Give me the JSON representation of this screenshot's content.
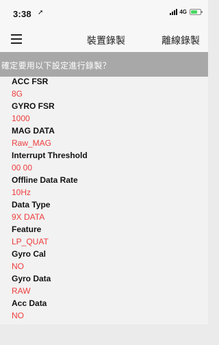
{
  "status_bar": {
    "time": "3:38",
    "network": "4G"
  },
  "nav": {
    "title": "裝置錄製",
    "action": "離線錄製"
  },
  "prompt": "確定要用以下設定進行錄製？",
  "settings": [
    {
      "label": "ACC FSR",
      "value": "8G"
    },
    {
      "label": "GYRO FSR",
      "value": "1000"
    },
    {
      "label": "MAG DATA",
      "value": "Raw_MAG"
    },
    {
      "label": "Interrupt Threshold",
      "value": "00 00"
    },
    {
      "label": "Offline Data Rate",
      "value": "10Hz"
    },
    {
      "label": "Data Type",
      "value": "9X DATA"
    },
    {
      "label": "Feature",
      "value": "LP_QUAT"
    },
    {
      "label": "Gyro Cal",
      "value": "NO"
    },
    {
      "label": "Gyro Data",
      "value": "RAW"
    },
    {
      "label": "Acc Data",
      "value": "NO"
    }
  ],
  "colors": {
    "value_text": "#ee3b3b",
    "prompt_bar": "#a8a8a8",
    "battery": "#4cd964"
  },
  "icons": {
    "menu": "hamburger-icon",
    "location": "location-arrow-icon",
    "signal": "cellular-signal-icon",
    "battery": "battery-icon"
  }
}
